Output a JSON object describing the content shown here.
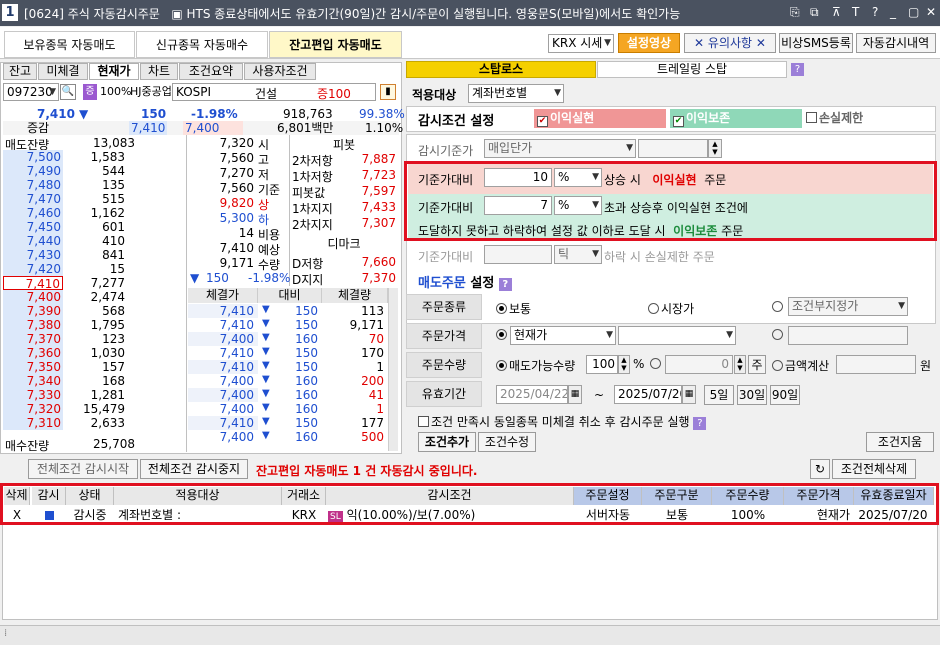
{
  "window": {
    "logo": "1",
    "title": "[0624] 주식 자동감시주문",
    "notice": "▣ HTS 종료상태에서도 유효기간(90일)간 감시/주문이 실행됩니다. 영웅문S(모바일)에서도 확인가능"
  },
  "top_tabs": [
    "보유종목 자동매도",
    "신규종목 자동매수",
    "잔고편입 자동매도"
  ],
  "top_right": {
    "market": "KRX 시세",
    "video_btn": "설정영상",
    "caution_btn": "유의사항",
    "sms_btn": "비상SMS등록",
    "history_btn": "자동감시내역"
  },
  "left_tabs": [
    "잔고",
    "미체결",
    "현재가",
    "차트",
    "조건요약",
    "사용자조건"
  ],
  "stock": {
    "code": "097230",
    "badge": "증",
    "rate": "100%",
    "name": "HJ중공업",
    "market": "KOSPI",
    "sector": "건설",
    "margin": "증100"
  },
  "quote": {
    "price": "7,410",
    "arrow": "▼",
    "change": "150",
    "pct": "-1.98%",
    "volume": "918,763",
    "ratio": "99.38%",
    "tag": "증감",
    "prev": "7,410",
    "cur": "7,400",
    "amount": "6,801백만",
    "ratio2": "1.10%"
  },
  "ask_header": "매도잔량",
  "bid_header": "매수잔량",
  "asks": [
    {
      "p": "7,500",
      "q": "1,583"
    },
    {
      "p": "7,490",
      "q": "544"
    },
    {
      "p": "7,480",
      "q": "135"
    },
    {
      "p": "7,470",
      "q": "515"
    },
    {
      "p": "7,460",
      "q": "1,162"
    },
    {
      "p": "7,450",
      "q": "601"
    },
    {
      "p": "7,440",
      "q": "410"
    },
    {
      "p": "7,430",
      "q": "841"
    },
    {
      "p": "7,420",
      "q": "15"
    },
    {
      "p": "7,410",
      "q": "7,277"
    }
  ],
  "total_ask": "13,083",
  "bids": [
    {
      "p": "7,400",
      "q": "2,474"
    },
    {
      "p": "7,390",
      "q": "568"
    },
    {
      "p": "7,380",
      "q": "1,795"
    },
    {
      "p": "7,370",
      "q": "123"
    },
    {
      "p": "7,360",
      "q": "1,030"
    },
    {
      "p": "7,350",
      "q": "157"
    },
    {
      "p": "7,340",
      "q": "168"
    },
    {
      "p": "7,330",
      "q": "1,281"
    },
    {
      "p": "7,320",
      "q": "15,479"
    },
    {
      "p": "7,310",
      "q": "2,633"
    }
  ],
  "total_bid": "25,708",
  "info": [
    {
      "v": "7,320",
      "l": "시"
    },
    {
      "v": "7,560",
      "l": "고"
    },
    {
      "v": "7,270",
      "l": "저"
    },
    {
      "v": "7,560",
      "l": "기준"
    },
    {
      "v": "9,820",
      "l": "상"
    },
    {
      "v": "5,300",
      "l": "하"
    },
    {
      "v": "14",
      "l": "비용"
    },
    {
      "v": "7,410",
      "l": "예상"
    },
    {
      "v": "9,171",
      "l": "수량"
    }
  ],
  "info_last": {
    "arrow": "▼",
    "v": "150",
    "pct": "-1.98%"
  },
  "pivot": {
    "title": "피봇",
    "rows": [
      {
        "l": "2차저항",
        "v": "7,887"
      },
      {
        "l": "1차저항",
        "v": "7,723"
      },
      {
        "l": "피봇값",
        "v": "7,597"
      },
      {
        "l": "1차지지",
        "v": "7,433"
      },
      {
        "l": "2차지지",
        "v": "7,307"
      }
    ]
  },
  "demark": {
    "title": "디마크",
    "rows": [
      {
        "l": "D저항",
        "v": "7,660"
      },
      {
        "l": "D지지",
        "v": "7,370"
      }
    ]
  },
  "trades": {
    "headers": [
      "체결가",
      "대비",
      "체결량"
    ],
    "rows": [
      [
        "7,410",
        "150",
        "113"
      ],
      [
        "7,410",
        "150",
        "9,171"
      ],
      [
        "7,400",
        "160",
        "70"
      ],
      [
        "7,410",
        "150",
        "170"
      ],
      [
        "7,410",
        "150",
        "1"
      ],
      [
        "7,400",
        "160",
        "200"
      ],
      [
        "7,400",
        "160",
        "41"
      ],
      [
        "7,400",
        "160",
        "1"
      ],
      [
        "7,410",
        "150",
        "177"
      ],
      [
        "7,400",
        "160",
        "500"
      ]
    ]
  },
  "right_tabs": [
    "스탑로스",
    "트레일링 스탑"
  ],
  "target": {
    "label": "적용대상",
    "value": "계좌번호별"
  },
  "cond": {
    "title": "감시조건 설정",
    "opt1": "이익실현",
    "opt2": "이익보존",
    "opt3": "손실제한"
  },
  "base": {
    "label": "감시기준가",
    "value": "매입단가"
  },
  "profit": {
    "label": "기준가대비",
    "value": "10",
    "unit": "%",
    "text1": "상승 시",
    "emph": "이익실현",
    "text2": "주문"
  },
  "preserve": {
    "label": "기준가대비",
    "value": "7",
    "unit": "%",
    "text1": "초과 상승후 이익실현 조건에",
    "line2a": "도달하지 못하고 하락하여 설정 값 이하로 도달 시",
    "emph": "이익보존",
    "line2b": "주문"
  },
  "loss": {
    "label": "기준가대비",
    "unit": "틱",
    "text": "하락 시 손실제한 주문"
  },
  "order": {
    "title1": "매도주문",
    "title2": "설정"
  },
  "otype": {
    "label": "주문종류",
    "r1": "보통",
    "r2": "시장가",
    "r3_sel": "조건부지정가"
  },
  "oprice": {
    "label": "주문가격",
    "sel": "현재가"
  },
  "oqty": {
    "label": "주문수량",
    "r1": "매도가능수량",
    "pct": "100",
    "unit": "%",
    "zero": "0",
    "ju": "주",
    "r2": "금액계산",
    "won": "원"
  },
  "valid": {
    "label": "유효기간",
    "from": "2025/04/22",
    "tilde": "~",
    "to": "2025/07/20",
    "d5": "5일",
    "d30": "30일",
    "d90": "90일"
  },
  "cancel_chk": "조건 만족시 동일종목 미체결 취소 후 감시주문 실행",
  "cond_btns": {
    "add": "조건추가",
    "edit": "조건수정",
    "del": "조건지움"
  },
  "bottom": {
    "start": "전체조건 감시시작",
    "stop": "전체조건 감시중지",
    "status": "잔고편입 자동매도 1 건 자동감시 중입니다.",
    "delall": "조건전체삭제"
  },
  "table": {
    "headers": [
      "삭제",
      "감시",
      "상태",
      "적용대상",
      "거래소",
      "감시조건",
      "주문설정",
      "주문구분",
      "주문수량",
      "주문가격",
      "유효종료일자"
    ],
    "row": {
      "del": "X",
      "state": "감시중",
      "target": "계좌번호별 :",
      "exch": "KRX",
      "badge": "SL",
      "cond": "익(10.00%)/보(7.00%)",
      "set": "서버자동",
      "kind": "보통",
      "qty": "100%",
      "price": "현재가",
      "end": "2025/07/20"
    }
  },
  "colors": {
    "accent": "#f5a623",
    "title_bg": "#4a5260",
    "alert": "#e01020",
    "profit_bg": "#f8d6d0",
    "preserve_bg": "#cfeee0"
  }
}
